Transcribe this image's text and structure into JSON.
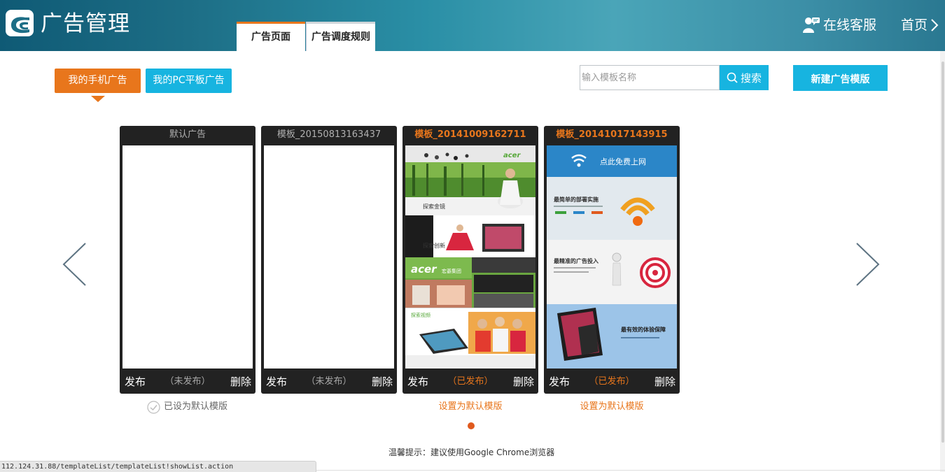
{
  "header": {
    "title": "广告管理",
    "tabs": [
      {
        "label": "广告页面",
        "active": true
      },
      {
        "label": "广告调度规则",
        "active": false
      }
    ],
    "support_label": "在线客服",
    "home_label": "首页"
  },
  "toolbar": {
    "mobile_ads_label": "我的手机广告",
    "pc_ads_label": "我的PC平板广告",
    "search_placeholder": "输入模板名称",
    "search_label": "搜索",
    "new_template_label": "新建广告模版"
  },
  "cards": [
    {
      "title": "默认广告",
      "publish": "发布",
      "status": "（未发布）",
      "delete": "删除",
      "below": "已设为默认模版"
    },
    {
      "title": "模板_20150813163437",
      "publish": "发布",
      "status": "（未发布）",
      "delete": "删除",
      "below": ""
    },
    {
      "title": "模板_20141009162711",
      "publish": "发布",
      "status": "（已发布）",
      "delete": "删除",
      "below": "设置为默认模版",
      "preview": {
        "s1_brand": "acer",
        "s1_caption": "探索金镜",
        "s2_caption": "探索创新",
        "s3_brand": "acer",
        "s3_sub": "宏碁集团",
        "s4_caption": "探索视频"
      }
    },
    {
      "title": "模板_20141017143915",
      "publish": "发布",
      "status": "（已发布）",
      "delete": "删除",
      "below": "设置为默认模版",
      "preview": {
        "banner": "点此免费上网",
        "p1": "最简单的部署实施",
        "p2": "最精准的广告投入",
        "p3": "最有效的体验保障"
      }
    }
  ],
  "tip": "温馨提示：建议使用Google Chrome浏览器",
  "status_url": "112.124.31.88/templateList/templateList!showList.action",
  "colors": {
    "accent_orange": "#e8761c",
    "accent_blue": "#17b4e0",
    "card_bg": "#222222"
  }
}
